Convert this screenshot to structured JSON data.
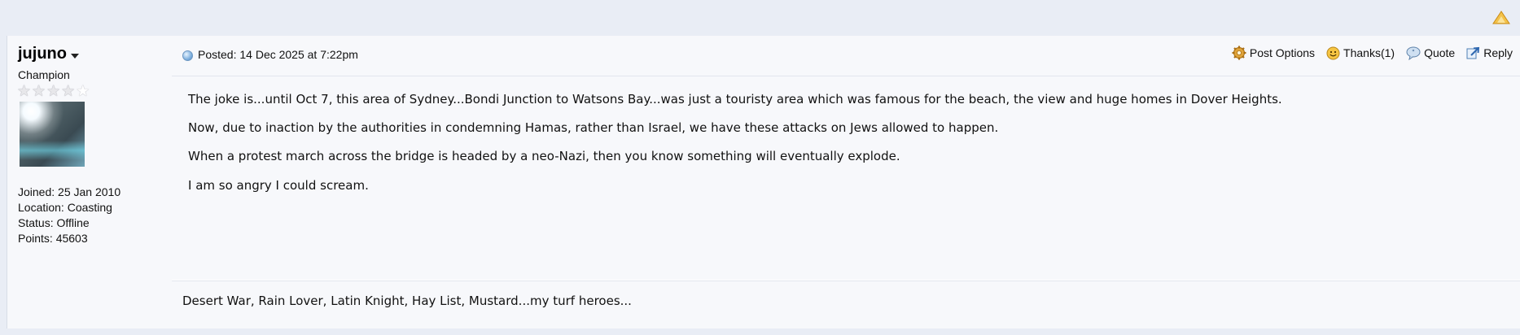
{
  "user": {
    "name": "jujuno",
    "rank": "Champion",
    "stars": {
      "filled": 4,
      "total": 5
    },
    "joined": "Joined: 25 Jan 2010",
    "location": "Location: Coasting",
    "status": "Status: Offline",
    "points": "Points: 45603"
  },
  "post": {
    "posted": "Posted: 14 Dec 2025 at 7:22pm",
    "actions": {
      "options": "Post Options",
      "thanks": "Thanks(1)",
      "quote": "Quote",
      "reply": "Reply"
    },
    "paragraphs": [
      "The joke is...until Oct 7, this area of Sydney...Bondi Junction to Watsons Bay...was just a touristy area which was famous for the beach, the view and huge homes in Dover Heights.",
      "Now, due to inaction by the authorities in condemning Hamas, rather than Israel, we have these attacks on Jews allowed to happen.",
      "When a protest march across the bridge is headed by a neo-Nazi, then you know something will eventually explode.",
      "I am so angry I could scream."
    ],
    "signature": "Desert War, Rain Lover, Latin Knight, Hay List, Mustard...my turf heroes..."
  },
  "icons": {
    "top": "up-arrow-icon",
    "posted": "post-dot-icon",
    "options": "gear-icon",
    "thanks": "smiley-icon",
    "quote": "speech-bubble-icon",
    "reply": "reply-arrow-icon"
  },
  "colors": {
    "page_bg": "#e9edf5",
    "post_bg": "#f7f8fb",
    "arrow": "#e2a21f"
  }
}
